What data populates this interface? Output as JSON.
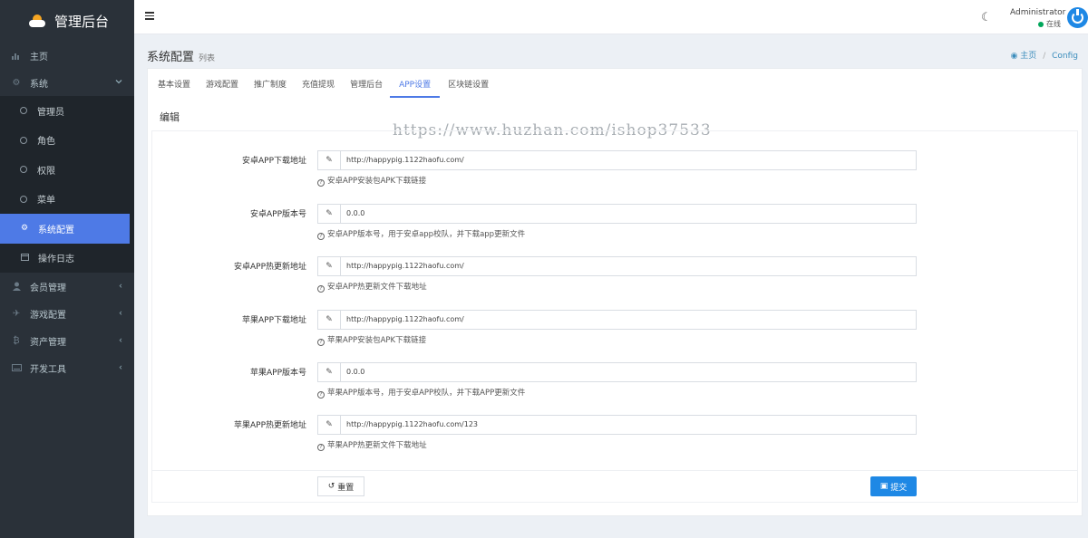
{
  "app": {
    "title": "管理后台"
  },
  "sidebar": {
    "items": [
      {
        "label": "主页",
        "icon": "bar-chart-icon"
      },
      {
        "label": "系统",
        "icon": "gear-icon",
        "expanded": true
      }
    ],
    "system_sub": [
      {
        "label": "管理员",
        "icon": "circle-icon"
      },
      {
        "label": "角色",
        "icon": "circle-icon"
      },
      {
        "label": "权限",
        "icon": "circle-icon"
      },
      {
        "label": "菜单",
        "icon": "circle-icon"
      },
      {
        "label": "系统配置",
        "icon": "cogs-icon",
        "active": true
      },
      {
        "label": "操作日志",
        "icon": "calendar-icon"
      }
    ],
    "groups": [
      {
        "label": "会员管理",
        "icon": "user-icon"
      },
      {
        "label": "游戏配置",
        "icon": "plane-icon"
      },
      {
        "label": "资产管理",
        "icon": "bitcoin-icon"
      },
      {
        "label": "开发工具",
        "icon": "keyboard-icon"
      }
    ]
  },
  "header": {
    "user_name": "Administrator",
    "status": "在线"
  },
  "page": {
    "title": "系统配置",
    "subtitle": "列表"
  },
  "breadcrumb": {
    "home": "主页",
    "sep": "/",
    "current": "Config"
  },
  "tabs": [
    "基本设置",
    "游戏配置",
    "推广制度",
    "充值提现",
    "管理后台",
    "APP设置",
    "区块链设置"
  ],
  "active_tab": "APP设置",
  "section": {
    "title": "编辑"
  },
  "watermark": "https://www.huzhan.com/ishop37533",
  "fields": [
    {
      "label": "安卓APP下载地址",
      "value": "http://happypig.1122haofu.com/",
      "help": "安卓APP安装包APK下载链接"
    },
    {
      "label": "安卓APP版本号",
      "value": "0.0.0",
      "help": "安卓APP版本号，用于安卓app校队，并下载app更新文件"
    },
    {
      "label": "安卓APP热更新地址",
      "value": "http://happypig.1122haofu.com/",
      "help": "安卓APP热更新文件下载地址"
    },
    {
      "label": "苹果APP下载地址",
      "value": "http://happypig.1122haofu.com/",
      "help": "苹果APP安装包APK下载链接"
    },
    {
      "label": "苹果APP版本号",
      "value": "0.0.0",
      "help": "苹果APP版本号，用于安卓APP校队，并下载APP更新文件"
    },
    {
      "label": "苹果APP热更新地址",
      "value": "http://happypig.1122haofu.com/123",
      "help": "苹果APP热更新文件下载地址"
    }
  ],
  "buttons": {
    "reset": "重置",
    "submit": "提交"
  },
  "colors": {
    "sidebar_bg": "#2a3139",
    "accent": "#4e7ae6",
    "primary": "#1e88e5",
    "online": "#00a65a"
  }
}
